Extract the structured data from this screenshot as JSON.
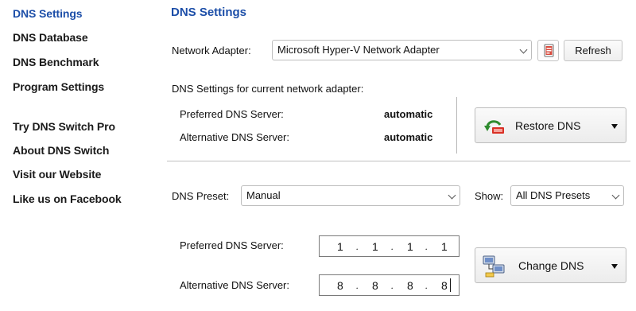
{
  "sidebar": {
    "items": [
      {
        "label": "DNS Settings"
      },
      {
        "label": "DNS Database"
      },
      {
        "label": "DNS Benchmark"
      },
      {
        "label": "Program Settings"
      },
      {
        "label": "Try DNS Switch Pro"
      },
      {
        "label": "About DNS Switch"
      },
      {
        "label": "Visit our Website"
      },
      {
        "label": "Like us on Facebook"
      }
    ]
  },
  "main": {
    "title": "DNS Settings",
    "network_adapter": {
      "label": "Network Adapter:",
      "value": "Microsoft Hyper-V Network Adapter",
      "refresh_label": "Refresh"
    },
    "current": {
      "heading": "DNS Settings for current network adapter:",
      "preferred_label": "Preferred DNS Server:",
      "preferred_value": "automatic",
      "alternative_label": "Alternative DNS Server:",
      "alternative_value": "automatic",
      "restore_label": "Restore DNS"
    },
    "preset": {
      "label": "DNS Preset:",
      "value": "Manual",
      "show_label": "Show:",
      "show_value": "All DNS Presets"
    },
    "manual": {
      "preferred_label": "Preferred DNS Server:",
      "preferred_octets": [
        "1",
        "1",
        "1",
        "1"
      ],
      "alternative_label": "Alternative DNS Server:",
      "alternative_octets": [
        "8",
        "8",
        "8",
        "8"
      ],
      "change_label": "Change DNS"
    }
  },
  "icons": {
    "copy": "copy-icon",
    "restore": "restore-icon",
    "change": "network-change-icon",
    "dropdown": "chevron-down-icon",
    "menu": "caret-down-icon"
  },
  "colors": {
    "accent": "#1c4ea8",
    "restore_arrow": "#2e8b2e",
    "restore_red": "#d93025"
  }
}
